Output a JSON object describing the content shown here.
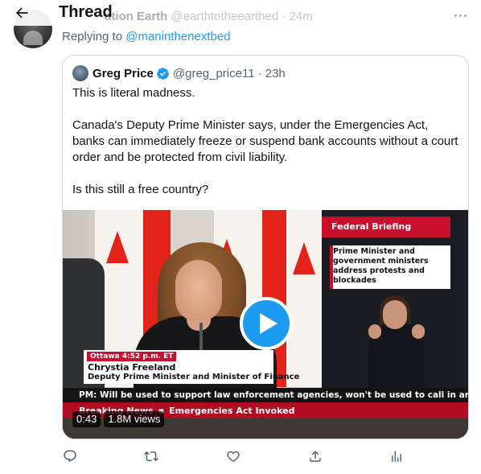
{
  "header": {
    "title": "Thread",
    "ghost_name": "ation Earth",
    "ghost_handle": "@earthtotheearthed",
    "ghost_time": "· 24m"
  },
  "reply": {
    "prefix": "Replying to ",
    "handle": "@maninthenextbed"
  },
  "quote": {
    "name": "Greg Price",
    "handle": "@greg_price11",
    "time": "· 23h",
    "text": "This is literal madness.\n\nCanada's Deputy Prime Minister says, under the Emergencies Act, banks can immediately freeze or suspend bank accounts without a court order and be protected from civil liability.\n\nIs this still a free country?",
    "video": {
      "federal_briefing": "Federal Briefing",
      "briefing_box": "Prime Minister and government ministers address protests and blockades",
      "location_tag": "Ottawa  4:52 p.m. ET",
      "speaker_name": "Chrystia Freeland",
      "speaker_role": "Deputy Prime Minister and Minister of Finance",
      "ticker": "PM: Will be used to support law enforcement agencies, won't be used to call in army",
      "breaking_label": "Breaking News",
      "breaking_sep": "▪",
      "breaking_headline": "Emergencies Act Invoked",
      "duration": "0:43",
      "views": "1.8M views"
    }
  },
  "actions": [
    "reply-icon",
    "retweet-icon",
    "like-icon",
    "share-icon",
    "analytics-icon"
  ],
  "colors": {
    "accent": "#1d9bf0",
    "text": "#0f1419",
    "muted": "#536471",
    "border": "#cfd9de",
    "cbc_red": "#c8102e"
  }
}
